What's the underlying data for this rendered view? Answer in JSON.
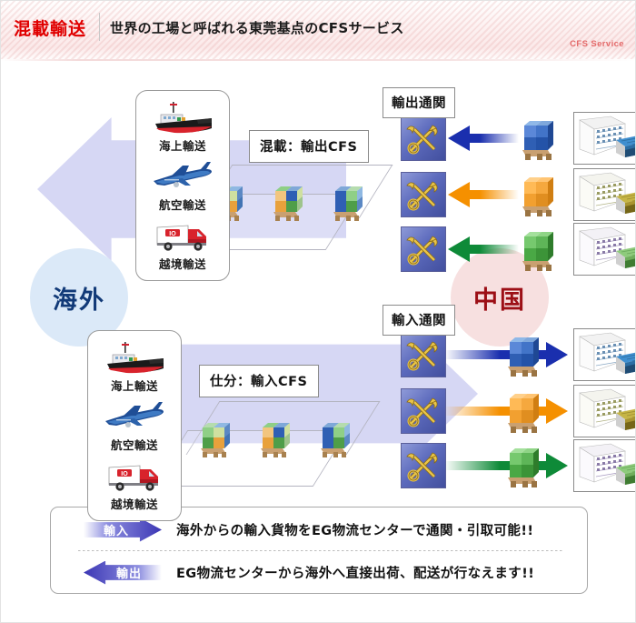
{
  "header": {
    "title": "混載輸送",
    "subtitle": "世界の工場と呼ばれる東莞基点のCFSサービス",
    "tag": "CFS Service",
    "title_color": "#e00000",
    "tag_color": "#e46a6a"
  },
  "regions": {
    "overseas": {
      "label": "海外",
      "text_color": "#123a78",
      "bg_color": "#dbe9f8"
    },
    "china": {
      "label": "中国",
      "text_color": "#9c0f16",
      "bg_color": "#f7e0e0"
    }
  },
  "flow": {
    "arrow_color": "#cdcef2",
    "export_direction": "left",
    "import_direction": "right"
  },
  "transport_modes": {
    "items": [
      {
        "icon": "cargo-ship-icon",
        "label": "海上輸送"
      },
      {
        "icon": "airplane-icon",
        "label": "航空輸送"
      },
      {
        "icon": "truck-icon",
        "label": "越境輸送"
      }
    ]
  },
  "cfs": {
    "export_label": "混載：輸出CFS",
    "import_label": "仕分：輸入CFS",
    "pallet_count": 3
  },
  "customs": {
    "export_label": "輸出通関",
    "import_label": "輸入通関",
    "icon": "customs-caduceus-icon",
    "rows": [
      {
        "color": "#1a2fae",
        "pallet_color": "blue",
        "factory_color": "#3f8fd0"
      },
      {
        "color": "#f59000",
        "pallet_color": "orange",
        "factory_color": "#b5a02c"
      },
      {
        "color": "#0e8a38",
        "pallet_color": "green",
        "factory_color": "#74be63"
      }
    ]
  },
  "footer": {
    "rows": [
      {
        "tag": "輸入",
        "direction": "right",
        "text": "海外からの輸入貨物をEG物流センターで通関・引取可能!!"
      },
      {
        "tag": "輸出",
        "direction": "left",
        "text": "EG物流センターから海外へ直接出荷、配送が行なえます!!"
      }
    ]
  }
}
